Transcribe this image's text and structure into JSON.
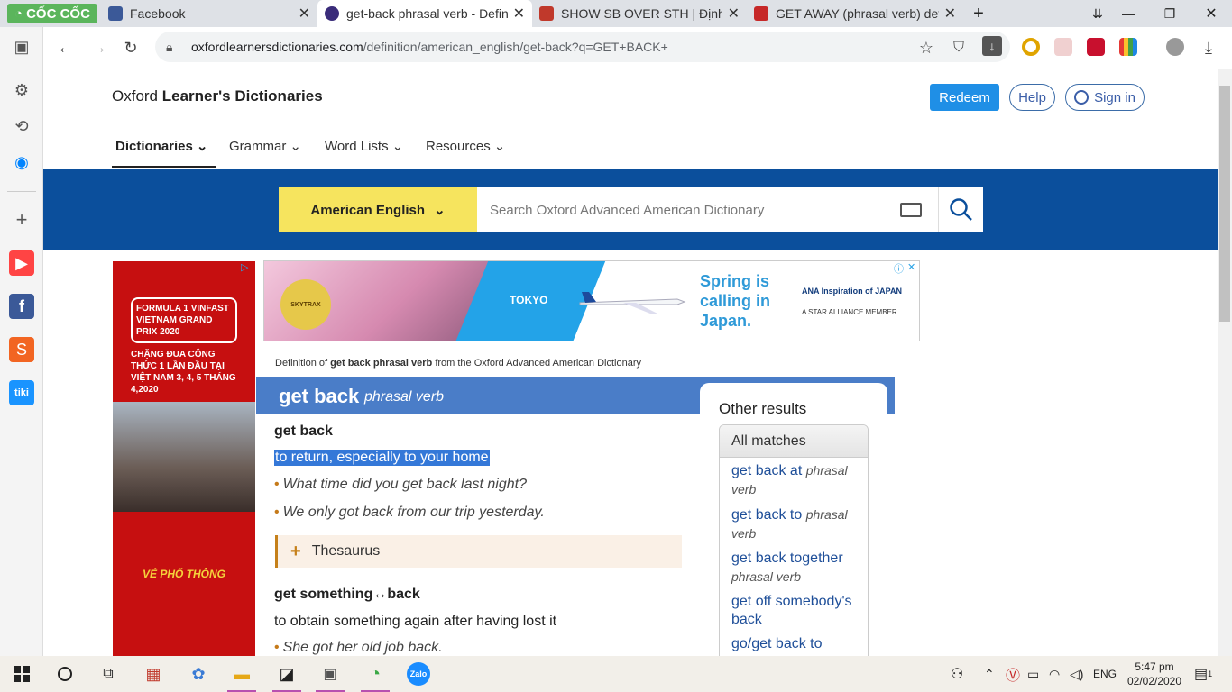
{
  "browser": {
    "brand": "CỐC CỐC",
    "tabs": [
      {
        "title": "Facebook",
        "favicon_color": "#3b5998"
      },
      {
        "title": "get-back phrasal verb - Defin",
        "favicon_color": "#3a2c7a"
      },
      {
        "title": "SHOW SB OVER STH | Định ng",
        "favicon_color": "#c0392b"
      },
      {
        "title": "GET AWAY (phrasal verb) defi",
        "favicon_color": "#c62828"
      }
    ],
    "url_host": "oxfordlearnersdictionaries.com",
    "url_path": "/definition/american_english/get-back?q=GET+BACK+"
  },
  "site": {
    "logo_prefix": "Oxford ",
    "logo_bold": "Learner's Dictionaries",
    "redeem": "Redeem",
    "help": "Help",
    "signin": "Sign in",
    "menu": [
      "Dictionaries",
      "Grammar",
      "Word Lists",
      "Resources"
    ],
    "dict_select": "American English",
    "search_placeholder": "Search Oxford Advanced American Dictionary"
  },
  "ads": {
    "left_title": "FORMULA 1 VINFAST VIETNAM GRAND PRIX 2020",
    "left_sub": "CHẶNG ĐUA CÔNG THỨC 1 LẦN ĐẦU TẠI VIỆT NAM 3, 4, 5 THÁNG 4,2020",
    "left_bottom": "VÉ PHỔ THÔNG",
    "banner_city": "TOKYO",
    "banner_slogan": "Spring is calling in Japan.",
    "banner_brand": "ANA Inspiration of JAPAN",
    "banner_alliance": "A STAR ALLIANCE MEMBER",
    "banner_badge": "SKYTRAX"
  },
  "entry": {
    "def_prefix": "Definition of ",
    "def_bold": "get back phrasal verb",
    "def_suffix": " from the Oxford Advanced American Dictionary",
    "headword": "get back",
    "pos": "phrasal verb",
    "sense1_head": "get back",
    "sense1_def": "to return, especially to your home",
    "sense1_ex1": "What time did you get back last night?",
    "sense1_ex2": "We only got back from our trip yesterday.",
    "thesaurus": "Thesaurus",
    "sense2_head": "get something↔back",
    "sense2_def": "to obtain something again after having lost it",
    "sense2_ex1": "She got her old job back."
  },
  "other_results": {
    "title": "Other results",
    "all_matches": "All matches",
    "items": [
      {
        "text": "get back at",
        "pos": "phrasal verb"
      },
      {
        "text": "get back to",
        "pos": "phrasal verb"
      },
      {
        "text": "get back together",
        "pos": "phrasal verb"
      },
      {
        "text": "get off somebody's back",
        "pos": ""
      },
      {
        "text": "go/get back to",
        "pos": ""
      }
    ]
  },
  "taskbar": {
    "lang": "ENG",
    "time": "5:47 pm",
    "date": "02/02/2020",
    "notifications": "1"
  }
}
